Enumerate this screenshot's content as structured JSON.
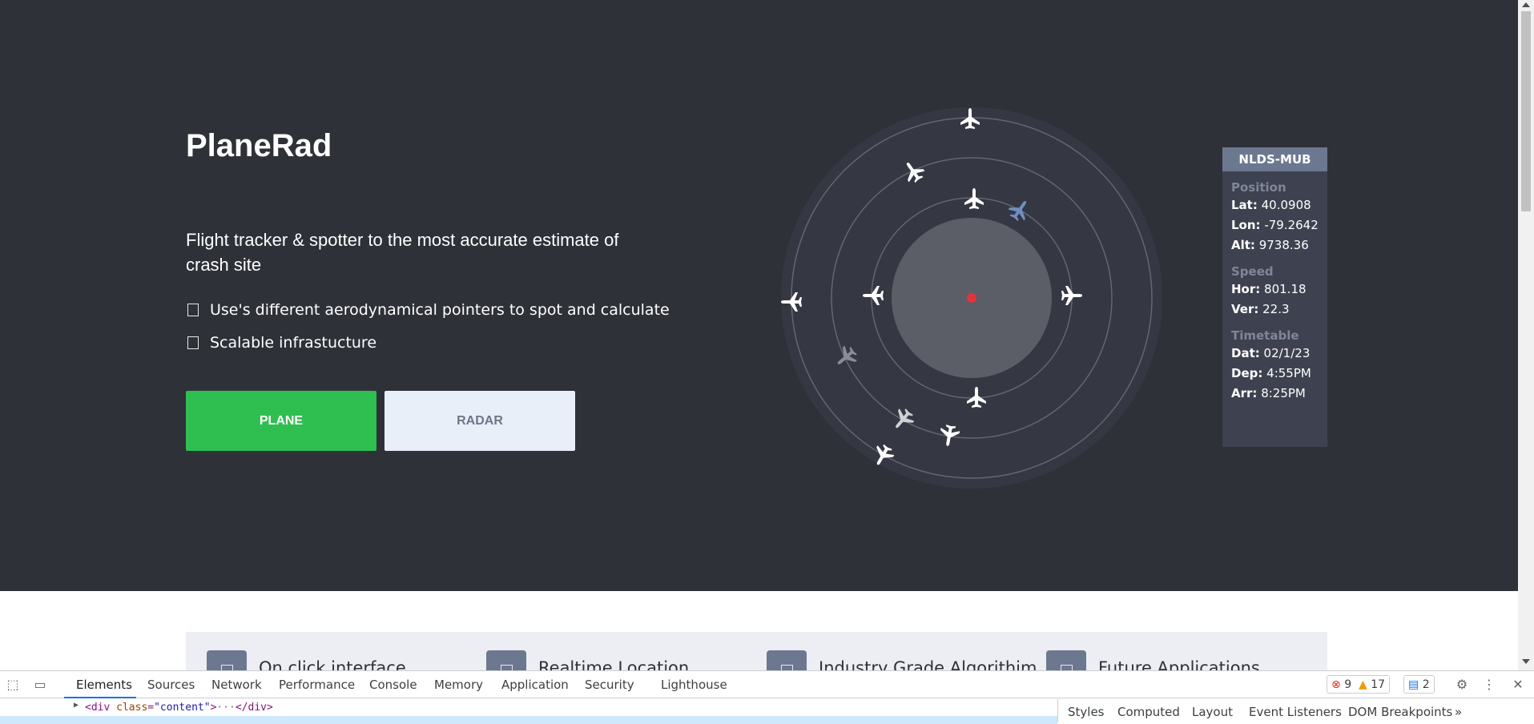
{
  "hero": {
    "title": "PlaneRad",
    "subtitle": "Flight tracker & spotter to the most accurate estimate of crash site",
    "features": [
      "Use's different aerodynamical pointers to spot and calculate",
      "Scalable infrastucture"
    ],
    "buttons": {
      "plane": "PLANE",
      "radar": "RADAR"
    }
  },
  "radar": {
    "center_color": "#e4343b",
    "plane_icon": "airplane-icon"
  },
  "info_panel": {
    "header": "NLDS-MUB",
    "position": {
      "title": "Position",
      "lat_label": "Lat:",
      "lat": "40.0908",
      "lon_label": "Lon:",
      "lon": "-79.2642",
      "alt_label": "Alt:",
      "alt": "9738.36"
    },
    "speed": {
      "title": "Speed",
      "hor_label": "Hor:",
      "hor": "801.18",
      "ver_label": "Ver:",
      "ver": "22.3"
    },
    "timetable": {
      "title": "Timetable",
      "dat_label": "Dat:",
      "dat": "02/1/23",
      "dep_label": "Dep:",
      "dep": "4:55PM",
      "arr_label": "Arr:",
      "arr": "8:25PM"
    }
  },
  "lower": {
    "items": [
      "On click interface",
      "Realtime Location",
      "Industry Grade Algorithim",
      "Future Applications"
    ]
  },
  "devtools": {
    "tabs": [
      "Elements",
      "Sources",
      "Network",
      "Performance",
      "Console",
      "Memory",
      "Application",
      "Security",
      "Lighthouse"
    ],
    "errors": "9",
    "warnings": "17",
    "messages": "2",
    "dom_line1": {
      "tag_open": "<div",
      "attr": "class",
      "val": "\"content\"",
      "close": ">",
      "ellipsis": "···",
      "end": "</div>"
    },
    "side_tabs": [
      "Styles",
      "Computed",
      "Layout",
      "Event Listeners",
      "DOM Breakpoints"
    ],
    "more": "»"
  },
  "colors": {
    "hero_bg": "#2f3139",
    "plane_button": "#2fbe50",
    "radar_button": "#e9eff9",
    "panel_header": "#6c7890"
  }
}
